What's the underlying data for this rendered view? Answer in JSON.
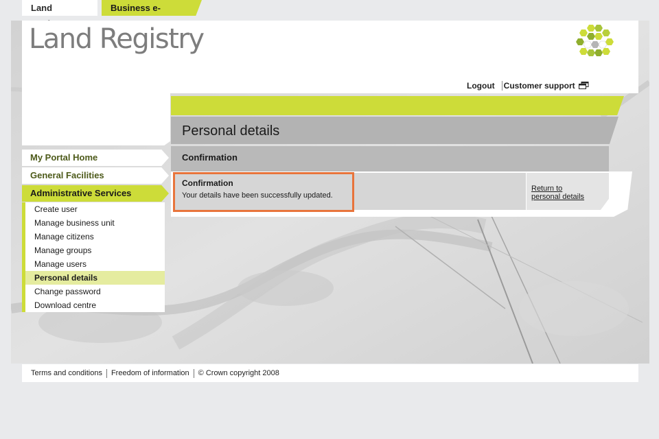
{
  "top_tabs": {
    "land_registry": "Land Registry",
    "business_eservices": "Business e-services"
  },
  "header": {
    "logo_text": "Land Registry",
    "logout": "Logout",
    "customer_support": "Customer support"
  },
  "sidebar": {
    "items": [
      {
        "label": "My Portal Home"
      },
      {
        "label": "General Facilities"
      },
      {
        "label": "Administrative Services"
      }
    ],
    "sub_items": [
      {
        "label": "Create user"
      },
      {
        "label": "Manage business unit"
      },
      {
        "label": "Manage citizens"
      },
      {
        "label": "Manage groups"
      },
      {
        "label": "Manage users"
      },
      {
        "label": "Personal details"
      },
      {
        "label": "Change password"
      },
      {
        "label": "Download centre"
      }
    ]
  },
  "main": {
    "page_title": "Personal details",
    "section_title": "Confirmation",
    "confirmation_heading": "Confirmation",
    "confirmation_message": "Your details have been successfully updated.",
    "return_link_line1": "Return to",
    "return_link_line2": "personal details"
  },
  "footer": {
    "terms": "Terms and conditions",
    "foi": "Freedom of information",
    "copyright": "© Crown copyright 2008"
  },
  "colors": {
    "accent_green": "#cddc39",
    "highlight_orange": "#e8743b",
    "page_bg": "#e9eaec"
  }
}
